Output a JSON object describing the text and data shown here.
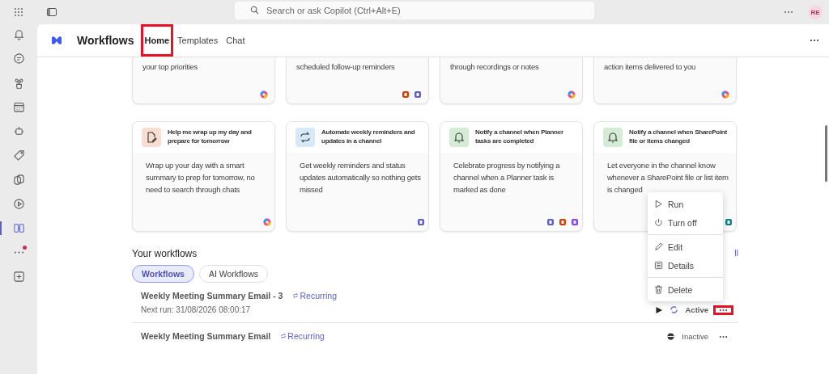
{
  "top_bar": {
    "search": {
      "placeholder": "Search or ask Copilot (Ctrl+Alt+E)"
    },
    "avatar": "RE"
  },
  "rail": [
    {
      "kind": "bell",
      "selected": false
    },
    {
      "kind": "chat",
      "selected": false
    },
    {
      "kind": "teams",
      "selected": false
    },
    {
      "kind": "calendar",
      "selected": false
    },
    {
      "kind": "bot",
      "selected": false
    },
    {
      "kind": "tag",
      "selected": false
    },
    {
      "kind": "loop",
      "selected": false
    },
    {
      "kind": "play",
      "selected": false
    },
    {
      "kind": "workflows",
      "selected": true
    },
    {
      "kind": "more",
      "selected": false,
      "badge": true
    },
    {
      "kind": "add",
      "selected": false
    }
  ],
  "app": {
    "name": "Workflows",
    "tabs": [
      {
        "label": "Home",
        "selected": true,
        "highlighted": true
      },
      {
        "label": "Templates",
        "selected": false,
        "highlighted": false
      },
      {
        "label": "Chat",
        "selected": false,
        "highlighted": false
      }
    ]
  },
  "top_cards": [
    {
      "text": "your top priorities",
      "apps": [
        {
          "kind": "copilot"
        }
      ]
    },
    {
      "text": "scheduled follow-up reminders",
      "apps": [
        {
          "kind": "office"
        },
        {
          "kind": "teams"
        }
      ]
    },
    {
      "text": "through recordings or notes",
      "apps": [
        {
          "kind": "copilot"
        }
      ]
    },
    {
      "text": "action items delivered to you",
      "apps": [
        {
          "kind": "copilot"
        }
      ]
    }
  ],
  "cards": [
    {
      "title": "Help me wrap up my day and prepare for tomorrow",
      "kind": "edit",
      "color": "#f9ddd3",
      "description": "Wrap up your day with a smart summary to prep for tomorrow, no need to search through chats",
      "apps": [
        {
          "kind": "copilot"
        }
      ]
    },
    {
      "title": "Automate weekly reminders and updates in a channel",
      "kind": "repeat",
      "color": "#d6e9f9",
      "description": "Get weekly reminders and status updates automatically so nothing gets missed",
      "apps": [
        {
          "kind": "teams"
        }
      ]
    },
    {
      "title": "Notify a channel when Planner tasks are completed",
      "kind": "bell",
      "color": "#d3ecd3",
      "description": "Celebrate progress by notifying a channel when a Planner task is marked as done",
      "apps": [
        {
          "kind": "teams"
        },
        {
          "kind": "office"
        },
        {
          "kind": "planner"
        }
      ]
    },
    {
      "title": "Notify a channel when SharePoint file or items changed",
      "kind": "bell",
      "color": "#d3ecd3",
      "description": "Let everyone in the channel know whenever a SharePoint file or list item is changed",
      "apps": [
        {
          "kind": "sharepoint"
        }
      ]
    }
  ],
  "your_workflows": {
    "heading": "Your workflows",
    "see_all": "ll",
    "filters": [
      {
        "label": "Workflows",
        "selected": true
      },
      {
        "label": "AI Workflows",
        "selected": false
      }
    ],
    "rows": [
      {
        "name": "Weekly Meeting Summary Email - 3",
        "schedule": "Recurring",
        "next_run": "Next run: 31/08/2026 08:00:17",
        "active": true,
        "status": "Active",
        "highlighted": true
      },
      {
        "name": "Weekly Meeting Summary Email",
        "schedule": "Recurring",
        "active": false,
        "status": "Inactive",
        "highlighted": false
      }
    ]
  },
  "menu": [
    {
      "label": "Run",
      "kind": "run"
    },
    {
      "label": "Turn off",
      "kind": "power"
    },
    {
      "kind": "divider"
    },
    {
      "label": "Edit",
      "kind": "pencil"
    },
    {
      "label": "Details",
      "kind": "details"
    },
    {
      "kind": "divider"
    },
    {
      "label": "Delete",
      "kind": "trash"
    }
  ]
}
